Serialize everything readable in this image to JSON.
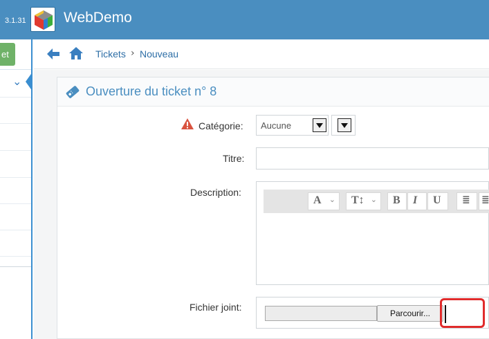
{
  "app": {
    "version": "3.1.31",
    "title": "WebDemo"
  },
  "sidebar": {
    "button_label": "et"
  },
  "breadcrumb": {
    "items": [
      "Tickets",
      "Nouveau"
    ],
    "separator": "›"
  },
  "panel": {
    "title": "Ouverture du ticket n° 8"
  },
  "form": {
    "category_label": "Catégorie:",
    "category_value": "Aucune",
    "title_label": "Titre:",
    "description_label": "Description:",
    "attachment_label": "Fichier joint:",
    "browse_label": "Parcourir..."
  },
  "editor": {
    "toolbar": [
      "A",
      "T↕",
      "B",
      "I",
      "U",
      "≣"
    ]
  },
  "colors": {
    "topbar": "#4a8ec0",
    "accent": "#3a8ed0",
    "sidebar_button": "#6fb268",
    "warning": "#d9533f",
    "highlight": "#e02b2b"
  }
}
